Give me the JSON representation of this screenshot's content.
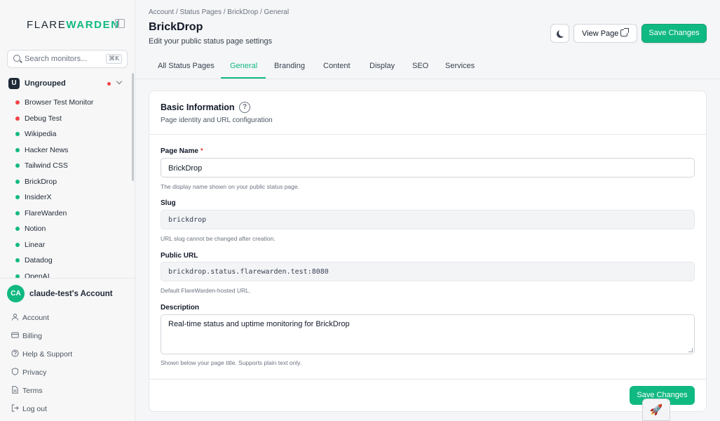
{
  "sidebar": {
    "brand_prefix": "FLARE",
    "brand_suffix": "WARDEN",
    "search_placeholder": "Search monitors...",
    "search_shortcut": "⌘K",
    "group": {
      "badge": "U",
      "name": "Ungrouped"
    },
    "monitors": [
      {
        "label": "Browser Test Monitor",
        "status": "down"
      },
      {
        "label": "Debug Test",
        "status": "down"
      },
      {
        "label": "Wikipedia",
        "status": "up"
      },
      {
        "label": "Hacker News",
        "status": "up"
      },
      {
        "label": "Tailwind CSS",
        "status": "up"
      },
      {
        "label": "BrickDrop",
        "status": "up"
      },
      {
        "label": "InsiderX",
        "status": "up"
      },
      {
        "label": "FlareWarden",
        "status": "up"
      },
      {
        "label": "Notion",
        "status": "up"
      },
      {
        "label": "Linear",
        "status": "up"
      },
      {
        "label": "Datadog",
        "status": "up"
      },
      {
        "label": "OpenAI",
        "status": "up"
      }
    ],
    "account": {
      "initials": "CA",
      "name": "claude-test's Account",
      "items": [
        "Account",
        "Billing",
        "Help & Support",
        "Privacy",
        "Terms",
        "Log out"
      ]
    }
  },
  "colors": {
    "accent": "#10b981",
    "down": "#ef4444",
    "up": "#10b981"
  },
  "header": {
    "breadcrumb": "Account / Status Pages / BrickDrop / General",
    "title": "BrickDrop",
    "subtitle": "Edit your public status page settings",
    "view_page": "View Page",
    "save": "Save Changes"
  },
  "tabs": [
    "All Status Pages",
    "General",
    "Branding",
    "Content",
    "Display",
    "SEO",
    "Services"
  ],
  "active_tab": "General",
  "form": {
    "section_title": "Basic Information",
    "section_subtitle": "Page identity and URL configuration",
    "page_name": {
      "label": "Page Name",
      "required": "*",
      "value": "BrickDrop",
      "hint": "The display name shown on your public status page."
    },
    "slug": {
      "label": "Slug",
      "value": "brickdrop",
      "hint": "URL slug cannot be changed after creation."
    },
    "public_url": {
      "label": "Public URL",
      "value": "brickdrop.status.flarewarden.test:8080",
      "hint": "Default FlareWarden-hosted URL."
    },
    "description": {
      "label": "Description",
      "value": "Real-time status and uptime monitoring for BrickDrop",
      "hint": "Shown below your page title. Supports plain text only."
    },
    "save": "Save Changes"
  },
  "icons": {
    "theme": "moon-icon",
    "external": "external-link-icon",
    "help": "help-circle-icon",
    "floating": "rocket-icon"
  }
}
